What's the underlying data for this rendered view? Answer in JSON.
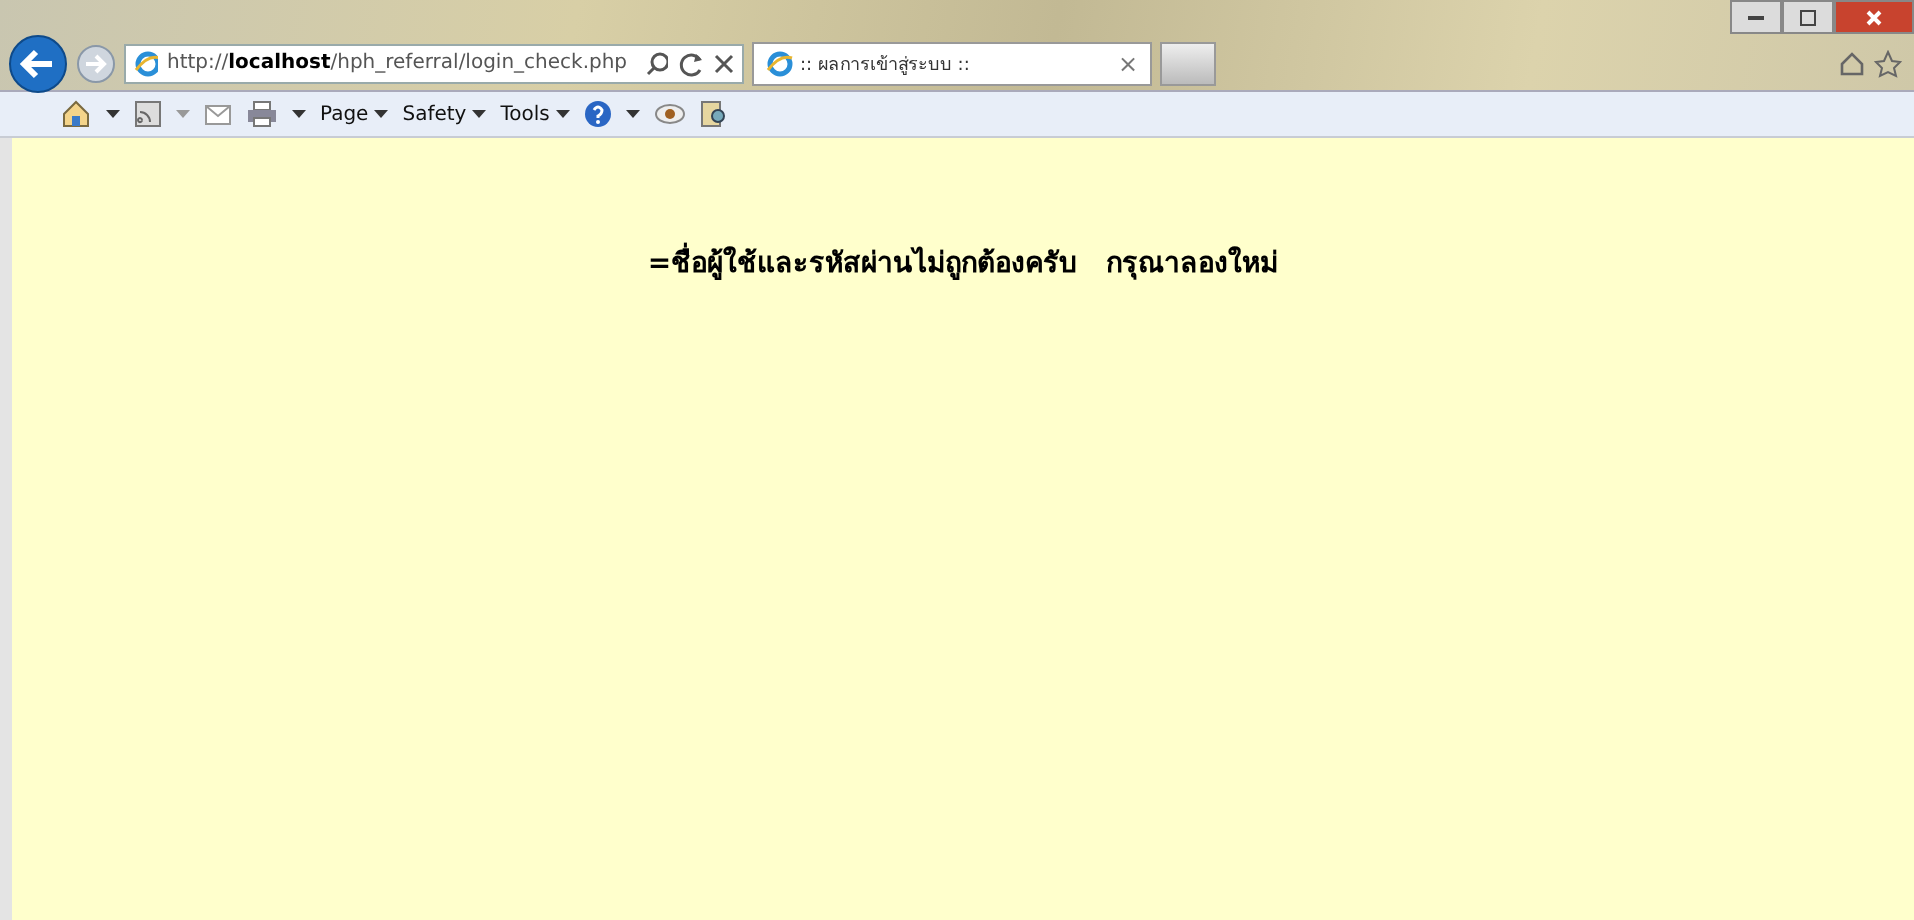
{
  "address_bar": {
    "url": "http://**localhost**/hph_referral/login_check.php"
  },
  "tabs": [
    {
      "title": ":: ผลการเข้าสู่ระบบ ::",
      "close": "×",
      "selected": true
    }
  ],
  "command_bar": {
    "items": [
      {
        "label": "Page"
      },
      {
        "label": "Safety"
      },
      {
        "label": "Tools"
      }
    ]
  },
  "page": {
    "message": "=ชื่อผู้ใช้และรหัสผ่านไม่ถูกต้องครับ   กรุณาลองใหม่"
  }
}
